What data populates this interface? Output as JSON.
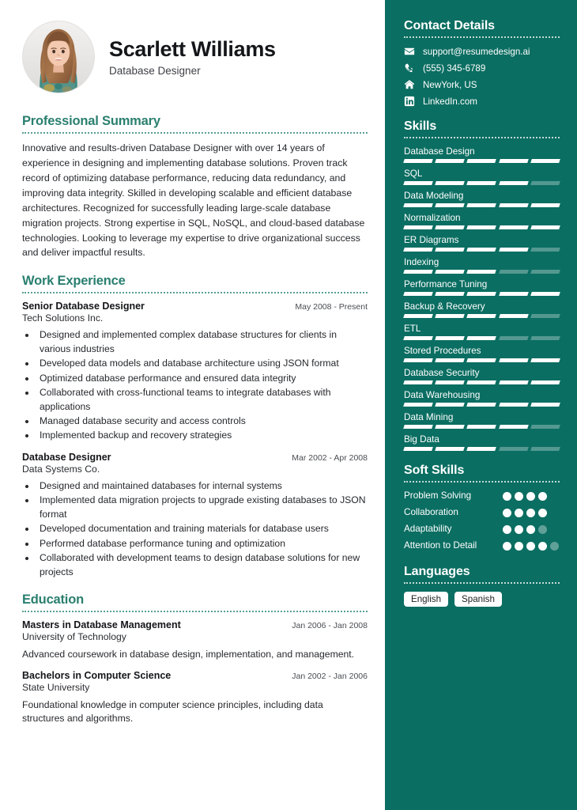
{
  "theme": {
    "sidebar_bg": "#0b6e62",
    "heading_color": "#2a7f6f",
    "text_color": "#26282c"
  },
  "header": {
    "name": "Scarlett Williams",
    "role": "Database Designer",
    "avatar_alt": "profile-photo"
  },
  "summary": {
    "title": "Professional Summary",
    "text": "Innovative and results-driven Database Designer with over 14 years of experience in designing and implementing database solutions. Proven track record of optimizing database performance, reducing data redundancy, and improving data integrity. Skilled in developing scalable and efficient database architectures. Recognized for successfully leading large-scale database migration projects. Strong expertise in SQL, NoSQL, and cloud-based database technologies. Looking to leverage my expertise to drive organizational success and deliver impactful results."
  },
  "work": {
    "title": "Work Experience",
    "jobs": [
      {
        "title": "Senior Database Designer",
        "date": "May 2008 - Present",
        "company": "Tech Solutions Inc.",
        "bullets": [
          "Designed and implemented complex database structures for clients in various industries",
          "Developed data models and database architecture using JSON format",
          "Optimized database performance and ensured data integrity",
          "Collaborated with cross-functional teams to integrate databases with applications",
          "Managed database security and access controls",
          "Implemented backup and recovery strategies"
        ]
      },
      {
        "title": "Database Designer",
        "date": "Mar 2002 - Apr 2008",
        "company": "Data Systems Co.",
        "bullets": [
          "Designed and maintained databases for internal systems",
          "Implemented data migration projects to upgrade existing databases to JSON format",
          "Developed documentation and training materials for database users",
          "Performed database performance tuning and optimization",
          "Collaborated with development teams to design database solutions for new projects"
        ]
      }
    ]
  },
  "education": {
    "title": "Education",
    "items": [
      {
        "degree": "Masters in Database Management",
        "date": "Jan 2006 - Jan 2008",
        "school": "University of Technology",
        "description": "Advanced coursework in database design, implementation, and management."
      },
      {
        "degree": "Bachelors in Computer Science",
        "date": "Jan 2002 - Jan 2006",
        "school": "State University",
        "description": "Foundational knowledge in computer science principles, including data structures and algorithms."
      }
    ]
  },
  "contact": {
    "title": "Contact Details",
    "items": [
      {
        "icon": "envelope-icon",
        "value": "support@resumedesign.ai"
      },
      {
        "icon": "phone-icon",
        "value": "(555) 345-6789"
      },
      {
        "icon": "home-icon",
        "value": "NewYork, US"
      },
      {
        "icon": "linkedin-icon",
        "value": "LinkedIn.com"
      }
    ]
  },
  "skills": {
    "title": "Skills",
    "max_level": 5,
    "items": [
      {
        "name": "Database Design",
        "level": 5
      },
      {
        "name": "SQL",
        "level": 4
      },
      {
        "name": "Data Modeling",
        "level": 5
      },
      {
        "name": "Normalization",
        "level": 5
      },
      {
        "name": "ER Diagrams",
        "level": 4
      },
      {
        "name": "Indexing",
        "level": 3
      },
      {
        "name": "Performance Tuning",
        "level": 5
      },
      {
        "name": "Backup & Recovery",
        "level": 4
      },
      {
        "name": "ETL",
        "level": 3
      },
      {
        "name": "Stored Procedures",
        "level": 5
      },
      {
        "name": "Database Security",
        "level": 5
      },
      {
        "name": "Data Warehousing",
        "level": 5
      },
      {
        "name": "Data Mining",
        "level": 4
      },
      {
        "name": "Big Data",
        "level": 3
      }
    ]
  },
  "soft_skills": {
    "title": "Soft Skills",
    "max_level": 4,
    "items": [
      {
        "name": "Problem Solving",
        "level": 4,
        "total": 4
      },
      {
        "name": "Collaboration",
        "level": 4,
        "total": 4
      },
      {
        "name": "Adaptability",
        "level": 3,
        "total": 4
      },
      {
        "name": "Attention to Detail",
        "level": 4,
        "total": 5
      }
    ]
  },
  "languages": {
    "title": "Languages",
    "items": [
      "English",
      "Spanish"
    ]
  }
}
